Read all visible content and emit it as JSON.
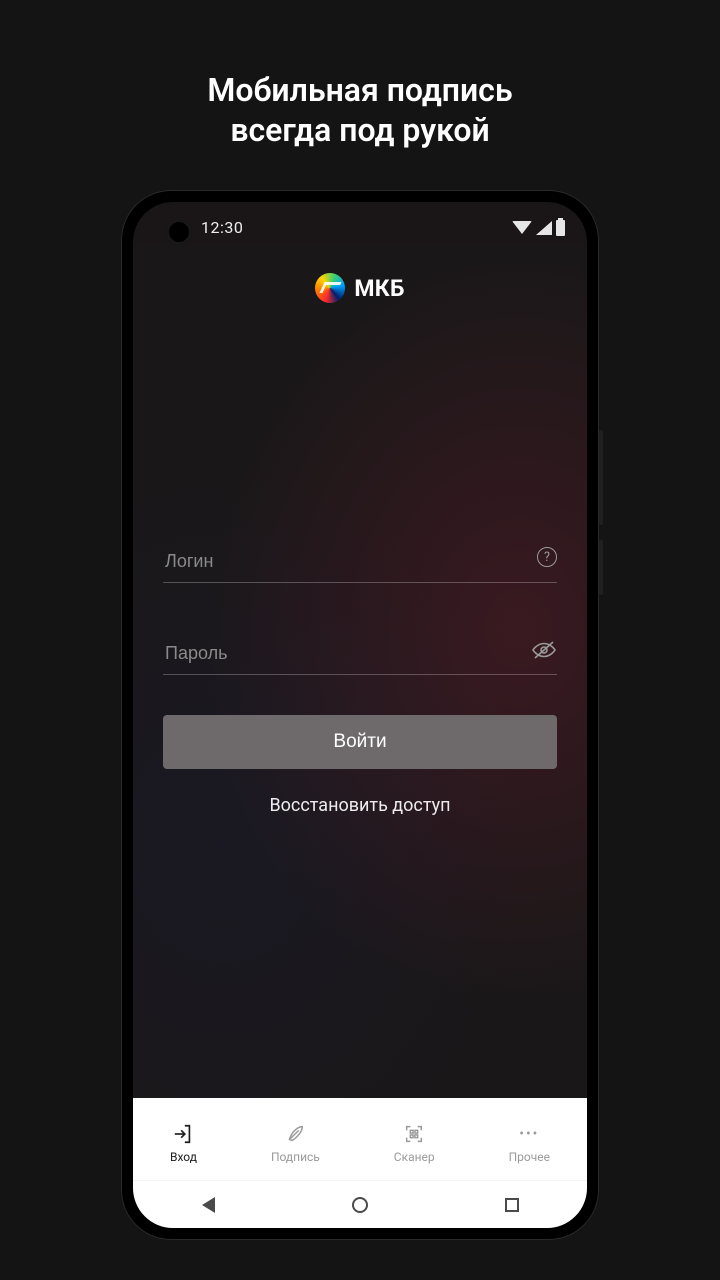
{
  "page": {
    "title_line1": "Мобильная подпись",
    "title_line2": "всегда под рукой"
  },
  "status": {
    "time": "12:30"
  },
  "brand": {
    "name": "МКБ"
  },
  "form": {
    "login_placeholder": "Логин",
    "password_placeholder": "Пароль",
    "submit_label": "Войти",
    "recover_label": "Восстановить доступ"
  },
  "tabs": [
    {
      "label": "Вход",
      "active": true
    },
    {
      "label": "Подпись",
      "active": false
    },
    {
      "label": "Сканер",
      "active": false
    },
    {
      "label": "Прочее",
      "active": false
    }
  ]
}
